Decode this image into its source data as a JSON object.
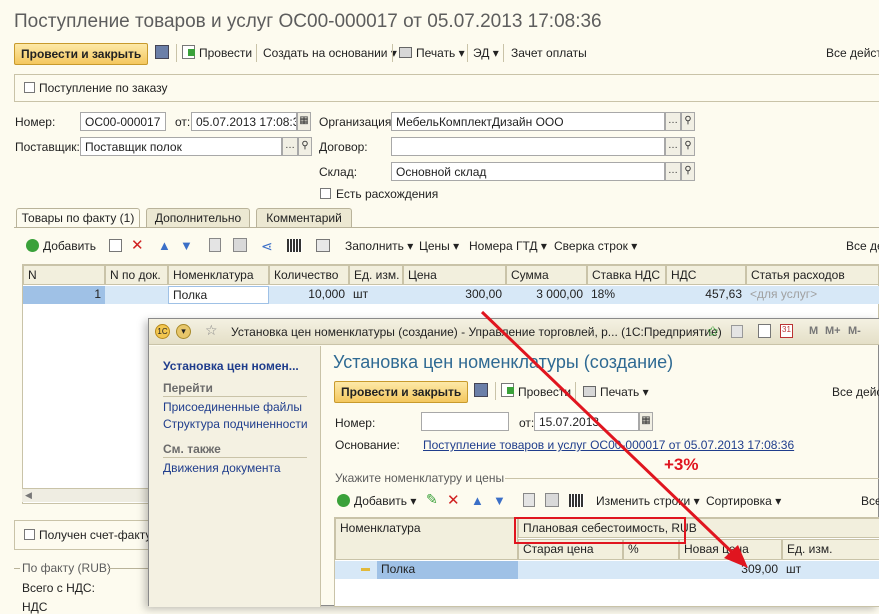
{
  "main": {
    "title": "Поступление товаров и услуг ОС00-000017 от 05.07.2013 17:08:36",
    "toolbar": {
      "post_close": "Провести и закрыть",
      "post": "Провести",
      "create_based": "Создать на основании",
      "print": "Печать",
      "ed": "ЭД",
      "offset": "Зачет оплаты",
      "all_actions": "Все действ"
    },
    "by_order_label": "Поступление по заказу",
    "number_label": "Номер:",
    "number_value": "ОС00-000017",
    "from_label": "от:",
    "date_value": "05.07.2013 17:08:36",
    "org_label": "Организация:",
    "org_value": "МебельКомплектДизайн ООО",
    "supplier_label": "Поставщик:",
    "supplier_value": "Поставщик полок",
    "contract_label": "Договор:",
    "contract_value": "",
    "warehouse_label": "Склад:",
    "warehouse_value": "Основной склад",
    "discrepancy_label": "Есть расхождения",
    "tabs": [
      "Товары по факту (1)",
      "Дополнительно",
      "Комментарий"
    ],
    "grid_toolbar": {
      "add": "Добавить",
      "fill": "Заполнить",
      "prices": "Цены",
      "gtd": "Номера ГТД",
      "reconcile": "Сверка строк",
      "all_actions": "Все дей"
    },
    "columns": [
      "N",
      "N по док.",
      "Номенклатура",
      "Количество",
      "Ед. изм.",
      "Цена",
      "Сумма",
      "Ставка НДС",
      "НДС",
      "Статья расходов"
    ],
    "row": {
      "n": "1",
      "n_doc": "",
      "item": "Полка",
      "qty": "10,000",
      "unit": "шт",
      "price": "300,00",
      "sum": "3 000,00",
      "vat_rate": "18%",
      "vat": "457,63",
      "expense": "<для услуг>"
    },
    "invoice_label": "Получен счет-фактура",
    "fact_header": "По факту (RUB)",
    "total_vat_label": "Всего с НДС:",
    "vat_label": "НДС"
  },
  "dialog": {
    "window_title": "Установка цен номенклатуры (создание) - Управление торговлей, р... (1С:Предприятие)",
    "title": "Установка цен номенклатуры (создание)",
    "side": {
      "current": "Установка цен номен...",
      "goto_header": "Перейти",
      "links": [
        "Присоединенные файлы",
        "Структура подчиненности"
      ],
      "see_also_header": "См. также",
      "see_also_links": [
        "Движения документа"
      ]
    },
    "toolbar": {
      "post_close": "Провести и закрыть",
      "post": "Провести",
      "print": "Печать",
      "all_actions": "Все дейс"
    },
    "number_label": "Номер:",
    "number_value": "",
    "from_label": "от:",
    "date_value": "15.07.2013",
    "basis_label": "Основание:",
    "basis_value": "Поступление товаров и услуг ОС00-000017 от 05.07.2013 17:08:36",
    "section_label": "Укажите номенклатуру и цены",
    "grid_toolbar": {
      "add": "Добавить",
      "change_rows": "Изменить строки",
      "sort": "Сортировка",
      "all_actions": "Все"
    },
    "columns": {
      "item": "Номенклатура",
      "price_type": "Плановая себестоимость, RUB",
      "old_price": "Старая цена",
      "percent": "%",
      "new_price": "Новая цена",
      "unit": "Ед. изм."
    },
    "row": {
      "item": "Полка",
      "old_price": "",
      "percent": "",
      "new_price": "309,00",
      "unit": "шт"
    }
  },
  "annotation": {
    "percent_label": "+3%",
    "color": "#e0151f"
  },
  "colors": {
    "title_gray": "#5d5d5d",
    "selected_row": "#d7e8f7",
    "button_gold": "#f4c75e",
    "link_blue": "#1f3d8c"
  }
}
